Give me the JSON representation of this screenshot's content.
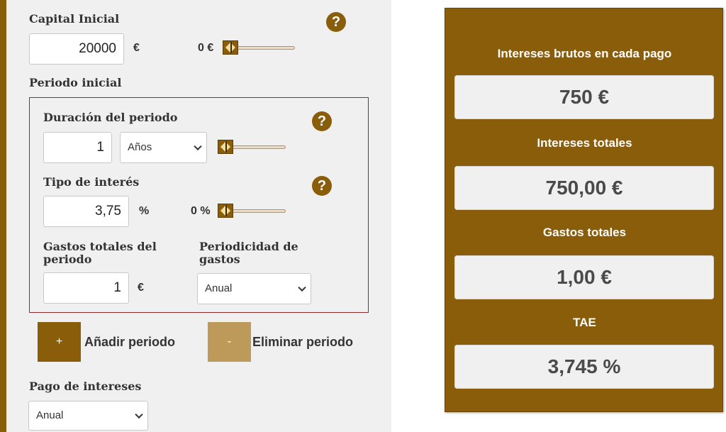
{
  "colors": {
    "accent": "#8a5d0b",
    "accent_light": "#bd9a5a",
    "period_border": "#8b2d2d",
    "panel_bg": "#f0f0f0"
  },
  "capital": {
    "label": "Capital Inicial",
    "value": "20000",
    "unit": "€",
    "slider_value": "0 €",
    "help_icon": "help-icon"
  },
  "periodo_inicial": {
    "title": "Periodo inicial",
    "duracion": {
      "label": "Duración del periodo",
      "value": "1",
      "select": "Años"
    },
    "tipo": {
      "label": "Tipo de interés",
      "value": "3,75",
      "unit": "%",
      "slider_value": "0 %"
    },
    "gastos": {
      "label": "Gastos totales del periodo",
      "value": "1",
      "unit": "€"
    },
    "periodicidad": {
      "label": "Periodicidad de gastos",
      "select": "Anual"
    }
  },
  "buttons": {
    "add": {
      "symbol": "+",
      "label": "Añadir periodo"
    },
    "remove": {
      "symbol": "-",
      "label": "Eliminar periodo"
    }
  },
  "pago": {
    "label": "Pago de intereses",
    "select": "Anual"
  },
  "results": {
    "intereses_brutos": {
      "label": "Intereses brutos en cada pago",
      "value": "750 €"
    },
    "intereses_totales": {
      "label": "Intereses totales",
      "value": "750,00 €"
    },
    "gastos_totales": {
      "label": "Gastos totales",
      "value": "1,00 €"
    },
    "tae": {
      "label": "TAE",
      "value": "3,745 %"
    }
  }
}
